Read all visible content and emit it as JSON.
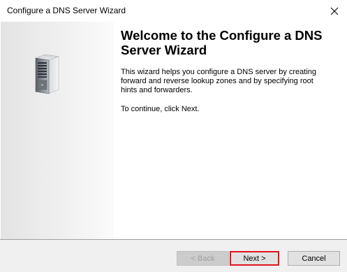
{
  "window": {
    "title": "Configure a DNS Server Wizard"
  },
  "icons": {
    "close": "close-icon",
    "server": "server-icon"
  },
  "main": {
    "heading": "Welcome to the Configure a DNS Server Wizard",
    "description": "This wizard helps you configure a DNS server by creating forward and reverse lookup zones and by specifying root hints and forwarders.",
    "continue_text": "To continue, click Next."
  },
  "buttons": {
    "back_label": "< Back",
    "next_label": "Next >",
    "cancel_label": "Cancel"
  },
  "colors": {
    "highlight": "#e0141e",
    "disabled_text": "#a0a0a0"
  }
}
